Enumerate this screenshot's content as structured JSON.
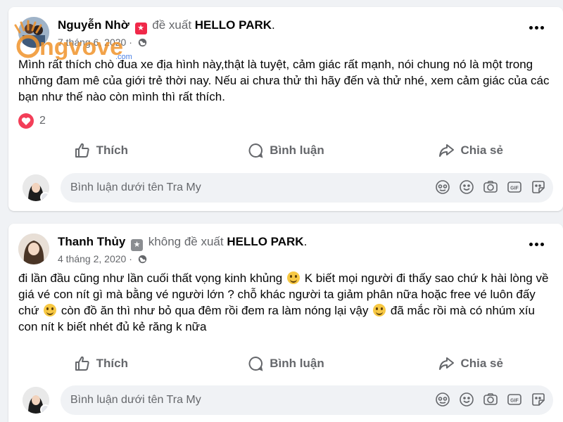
{
  "posts": [
    {
      "author": "Nguyễn Nhờ",
      "recommend_text": "đề xuất",
      "page_name": "HELLO PARK",
      "punct": ".",
      "date": "7 tháng 6, 2020 ·",
      "body": "Mình rất thích chò đua xe địa hình này,thật là tuyệt, cảm giác rất mạnh, nói chung nó là một trong những đam mê của giới trẻ thời nay. Nếu ai chưa thử thì hãy đến và thử nhé, xem cảm giác của các bạn như thế nào còn mình thì rất thích.",
      "reaction_count": "2"
    },
    {
      "author": "Thanh Thủy",
      "recommend_text": "không đề xuất",
      "page_name": "HELLO PARK",
      "punct": ".",
      "date": "4 tháng 2, 2020 ·",
      "body_parts": [
        "đi lần đầu cũng như lần cuối thất vọng kinh khủng",
        "K biết mọi người đi thấy sao chứ k hài lòng về giá vé con nít gì mà bằng vé người lớn ? chỗ khác người ta giảm phân nữa hoặc free vé luôn đấy chứ",
        "còn đồ ăn thì như bỏ qua đêm rồi đem ra làm nóng lại vậy",
        "đã mắc rồi mà có nhúm xíu con nít k biết nhét đủ kẻ răng k nữa"
      ]
    }
  ],
  "actions": {
    "like": "Thích",
    "comment": "Bình luận",
    "share": "Chia sẻ"
  },
  "comment_placeholder": "Bình luận dưới tên Tra My",
  "watermark": "ongvove.com",
  "colors": {
    "secondary_text": "#65676b",
    "reaction_heart": "#f33e58",
    "recommend_badge": "#f02849",
    "logo_orange": "#f0932b",
    "logo_blue": "#2d6be0"
  },
  "icons": [
    "like-icon",
    "comment-icon",
    "share-icon",
    "globe-icon",
    "heart-icon",
    "avatar-sticker-icon",
    "emoji-icon",
    "camera-icon",
    "gif-icon",
    "sticker-icon",
    "more-icon"
  ]
}
